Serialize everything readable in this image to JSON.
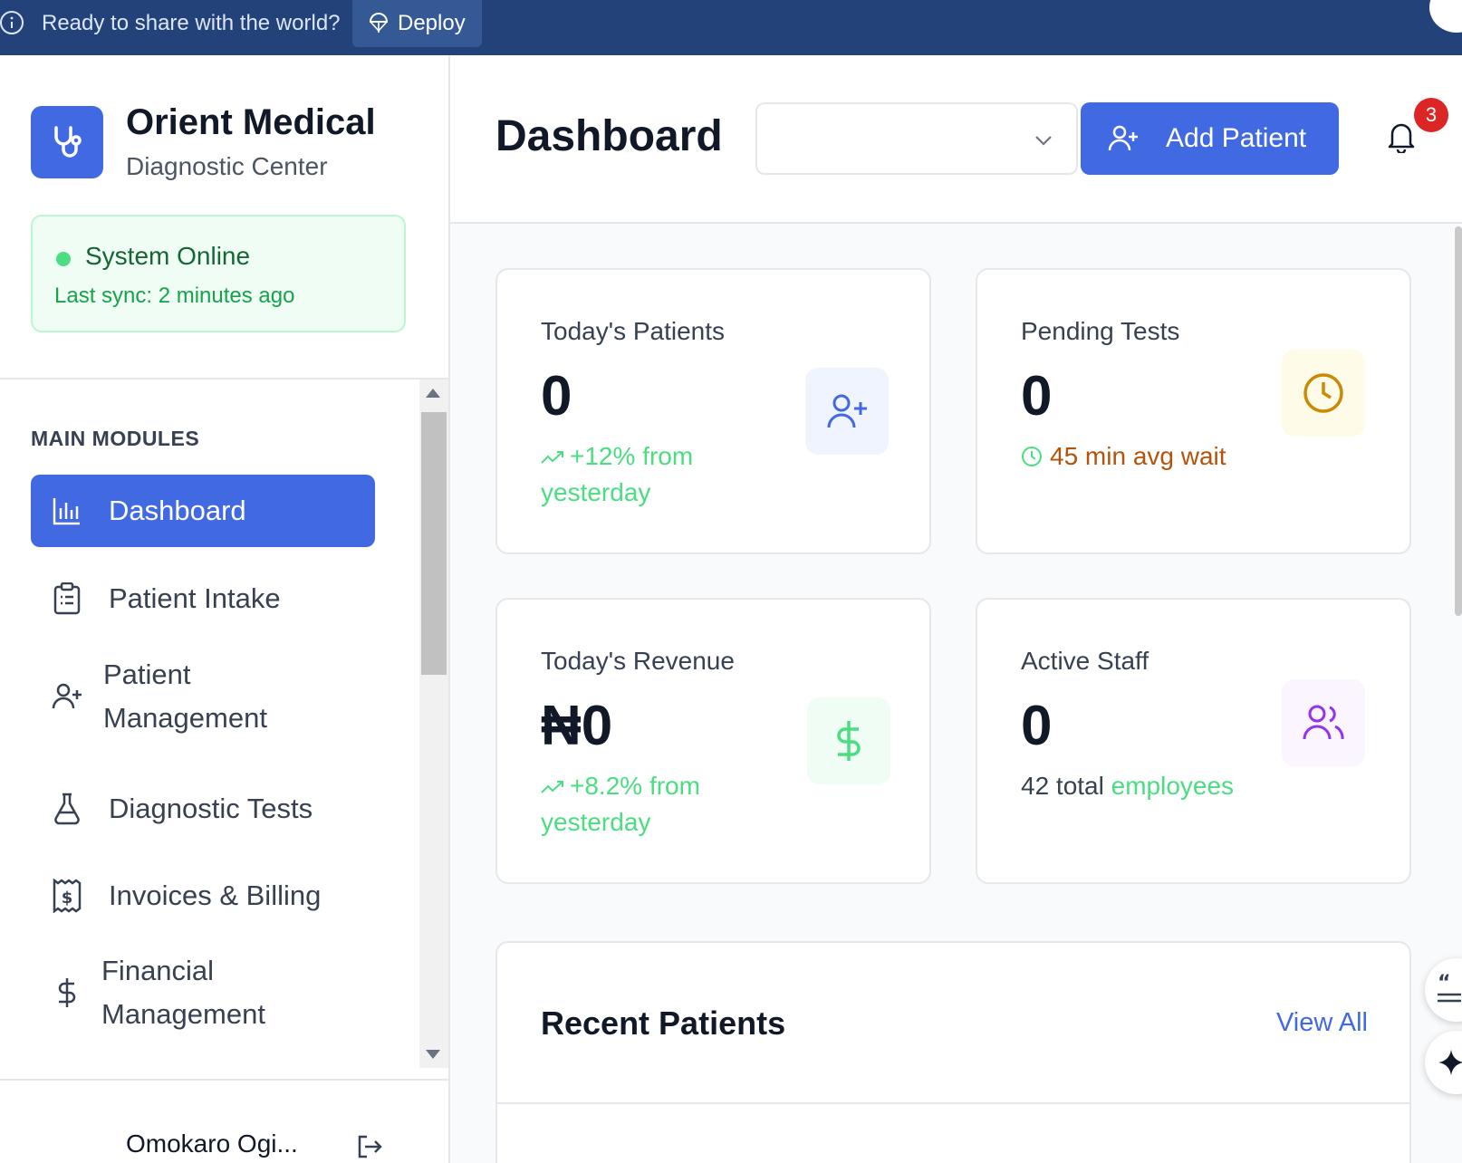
{
  "topbar": {
    "message": "Ready to share with the world?",
    "deploy_label": "Deploy",
    "colors": {
      "background": "#24427a",
      "button": "#345995"
    }
  },
  "brand": {
    "name": "Orient Medical",
    "subtitle": "Diagnostic Center",
    "logo_icon": "stethoscope-icon",
    "accent": "#4169e1"
  },
  "system_status": {
    "title": "System Online",
    "last_sync": "Last sync: 2 minutes ago",
    "color": "#16a34a"
  },
  "sidebar": {
    "section_label": "MAIN MODULES",
    "items": [
      {
        "label": "Dashboard",
        "icon": "bar-chart-icon",
        "active": true
      },
      {
        "label": "Patient Intake",
        "icon": "clipboard-list-icon",
        "active": false
      },
      {
        "label": "Patient\nManagement",
        "icon": "user-plus-icon",
        "active": false
      },
      {
        "label": "Diagnostic Tests",
        "icon": "flask-icon",
        "active": false
      },
      {
        "label": "Invoices & Billing",
        "icon": "receipt-icon",
        "active": false
      },
      {
        "label": "Financial\nManagement",
        "icon": "dollar-icon",
        "active": false
      }
    ],
    "user_name": "Omokaro Ogi..."
  },
  "header": {
    "title": "Dashboard",
    "select_value": "",
    "add_patient_label": "Add Patient",
    "notification_count": "3"
  },
  "stats": [
    {
      "label": "Today's Patients",
      "value": "0",
      "sub": "+12% from yesterday",
      "sub_color": "#4ade80",
      "icon": "user-plus-icon",
      "icon_bg": "#eff4ff",
      "icon_color": "#4169e1"
    },
    {
      "label": "Pending Tests",
      "value": "0",
      "sub": "45 min avg wait",
      "sub_color": "#b45309",
      "icon": "clock-icon",
      "icon_bg": "#fefce8",
      "icon_color": "#ca8a04"
    },
    {
      "label": "Today's Revenue",
      "value": "₦0",
      "sub": "+8.2% from yesterday",
      "sub_color": "#4ade80",
      "icon": "dollar-icon",
      "icon_bg": "#f0fdf4",
      "icon_color": "#4ade80"
    },
    {
      "label": "Active Staff",
      "value": "0",
      "sub_prefix": "42 total ",
      "sub": "employees",
      "sub_color": "#4ade80",
      "icon": "users-icon",
      "icon_bg": "#faf5ff",
      "icon_color": "#9333ea"
    }
  ],
  "recent_patients": {
    "title": "Recent Patients",
    "view_all_label": "View All"
  }
}
